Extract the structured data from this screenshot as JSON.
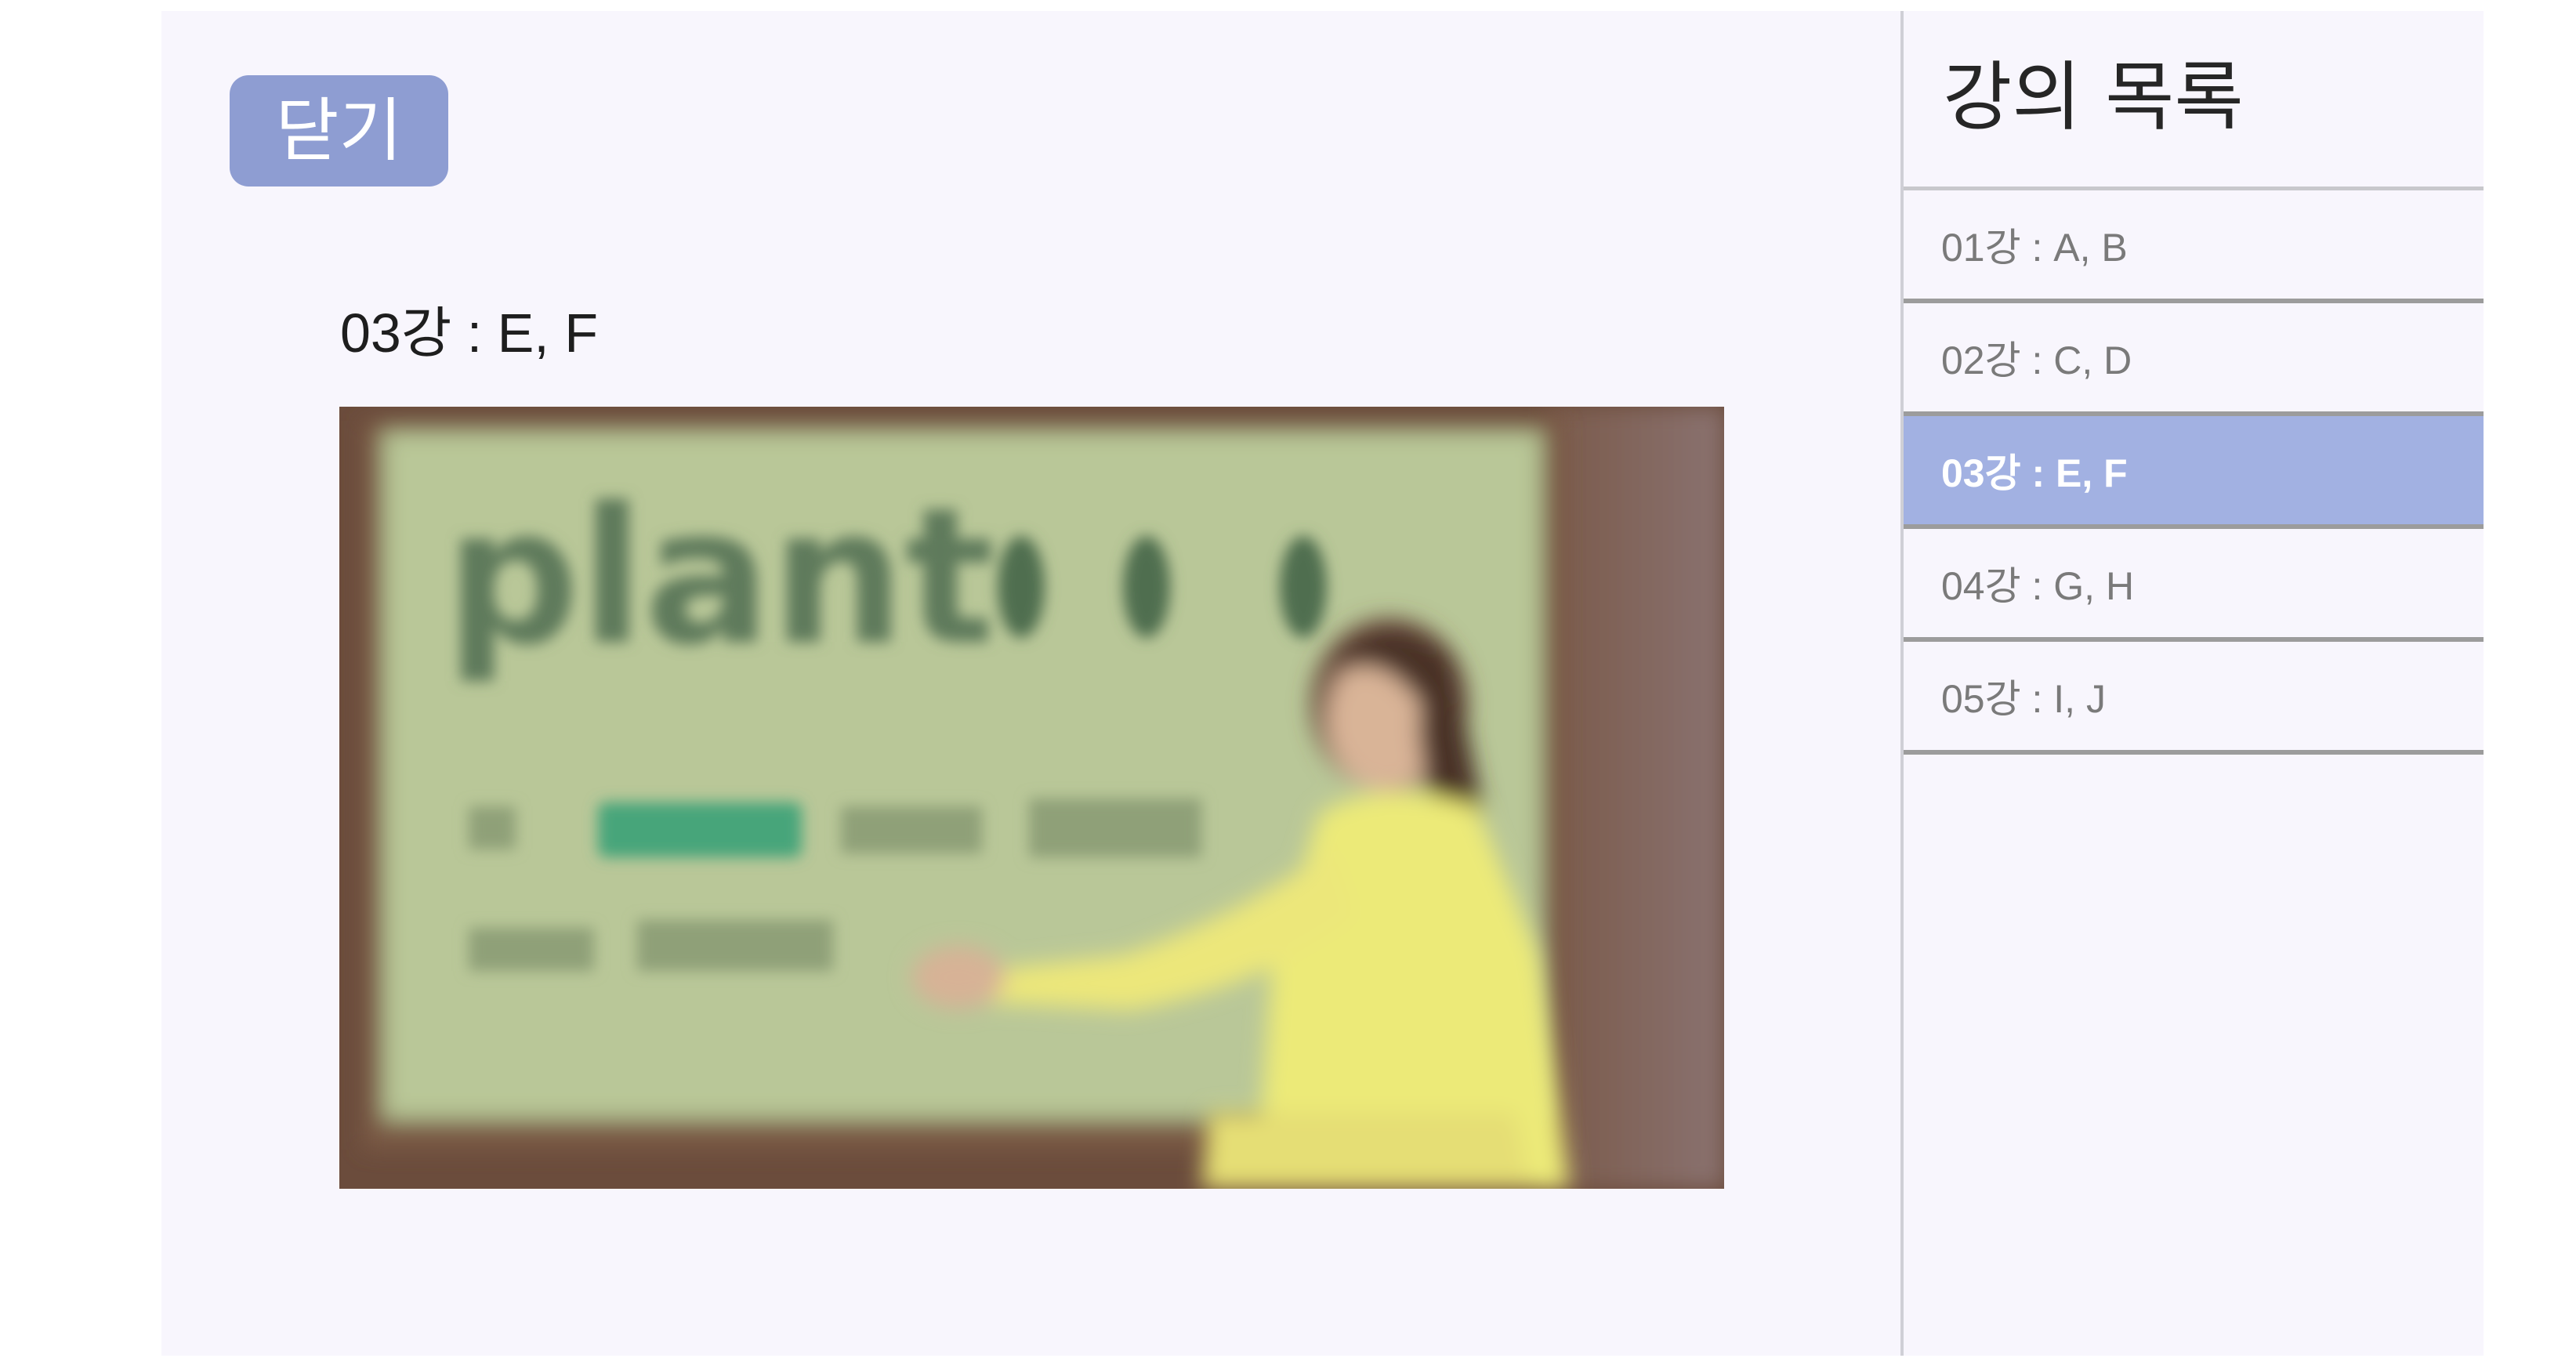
{
  "main": {
    "close_label": "닫기",
    "lecture_title": "03강 : E, F",
    "video": {
      "board_word": "plant"
    }
  },
  "sidebar": {
    "title": "강의 목록",
    "items": [
      {
        "label": "01강 : A, B",
        "active": false
      },
      {
        "label": "02강 : C, D",
        "active": false
      },
      {
        "label": "03강 : E, F",
        "active": true
      },
      {
        "label": "04강 : G, H",
        "active": false
      },
      {
        "label": "05강 : I, J",
        "active": false
      }
    ]
  },
  "colors": {
    "page_bg": "#f8f6fd",
    "close_button_bg": "#8e9dd2",
    "active_item_bg": "#a2b1e2",
    "inactive_item_text": "#7a7a7a"
  }
}
